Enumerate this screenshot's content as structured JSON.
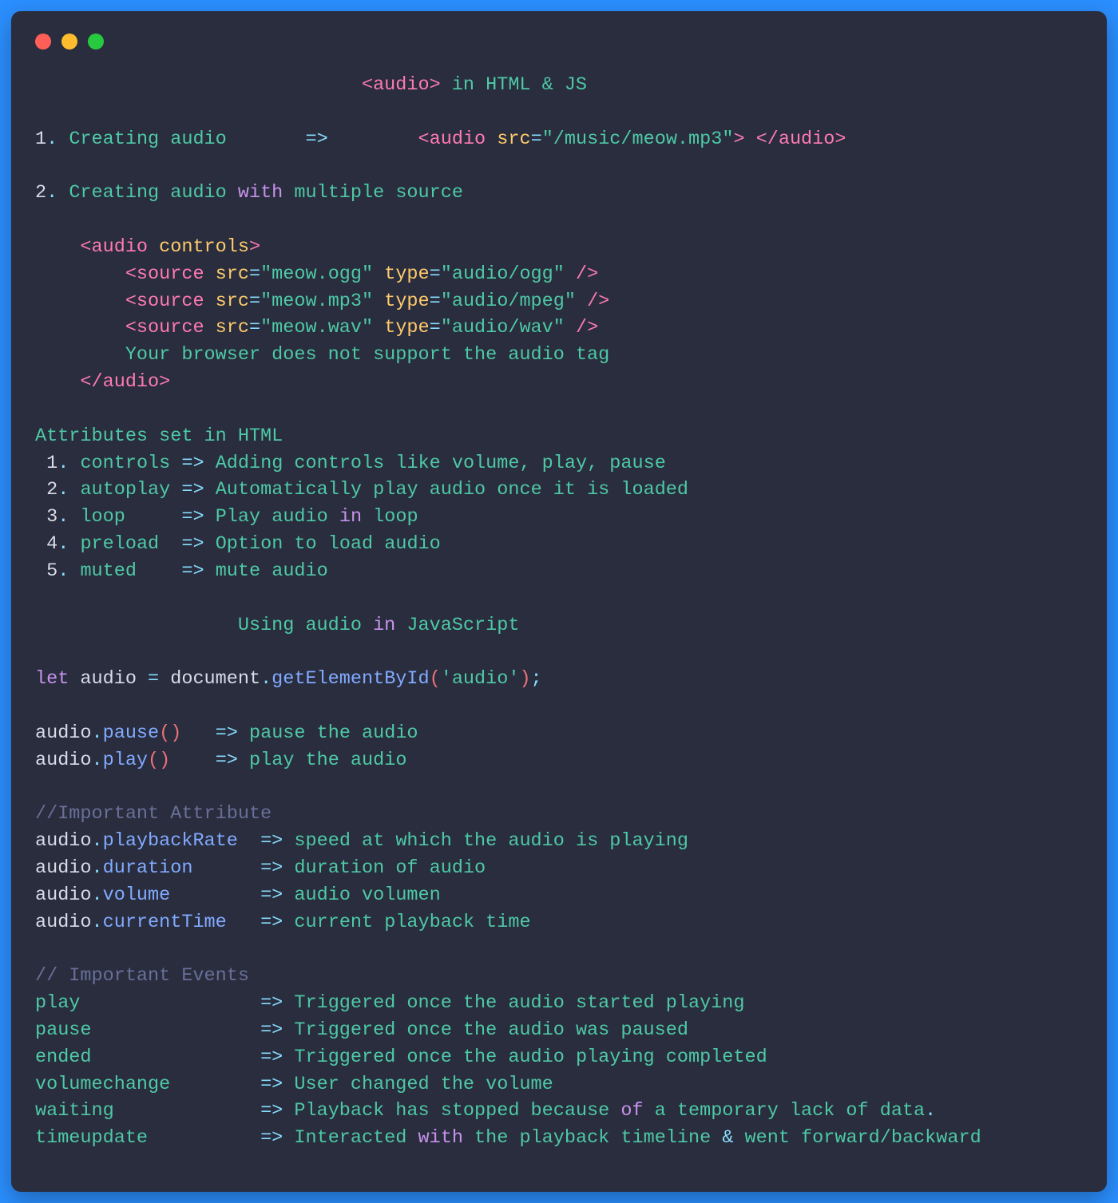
{
  "title_parts": {
    "audio_tag": "<audio>",
    "in": " in ",
    "html_js": "HTML & JS"
  },
  "section1": {
    "num": "1",
    "dot": ". ",
    "label": "Creating audio",
    "arrow": "=>",
    "audio_open": "<audio",
    "src_attr": " src",
    "eq": "=",
    "src_val": "\"/music/meow.mp3\"",
    "close_gt": ">",
    "audio_close": " </audio>"
  },
  "section2": {
    "num": "2",
    "dot": ". ",
    "label": "Creating audio ",
    "with": "with",
    "rest": " multiple source"
  },
  "audio_block": {
    "open_tag": "<audio",
    "controls": " controls",
    "gt": ">",
    "sources": [
      {
        "src": "\"meow.ogg\"",
        "type": "\"audio/ogg\""
      },
      {
        "src": "\"meow.mp3\"",
        "type": "\"audio/mpeg\""
      },
      {
        "src": "\"meow.wav\"",
        "type": "\"audio/wav\""
      }
    ],
    "source_tag": "<source",
    "src_lbl": " src",
    "type_lbl": " type",
    "self_close": " />",
    "fallback": "Your browser does not support the audio tag",
    "close_tag": "</audio>"
  },
  "attrs_heading": "Attributes set in HTML",
  "attributes": [
    {
      "n": "1",
      "name": "controls",
      "pad": " ",
      "desc": "Adding controls like volume, play, pause"
    },
    {
      "n": "2",
      "name": "autoplay",
      "pad": " ",
      "desc": "Automatically play audio once it is loaded"
    },
    {
      "n": "3",
      "name": "loop",
      "pad": "     ",
      "desc_pre": "Play audio ",
      "in": "in",
      "desc_post": " loop"
    },
    {
      "n": "4",
      "name": "preload",
      "pad": "  ",
      "desc": "Option to load audio"
    },
    {
      "n": "5",
      "name": "muted",
      "pad": "    ",
      "desc": "mute audio"
    }
  ],
  "js_heading": {
    "using": "Using audio ",
    "in": "in",
    "js": " JavaScript"
  },
  "let_line": {
    "let": "let",
    "var": " audio ",
    "eq": "=",
    "doc": " document",
    "dot": ".",
    "fn": "getElementById",
    "lp": "(",
    "arg": "'audio'",
    "rp_semi": ");"
  },
  "methods": [
    {
      "obj": "audio",
      "dot": ".",
      "name": "pause",
      "parens": "()",
      "pad": "   ",
      "desc": "pause the audio"
    },
    {
      "obj": "audio",
      "dot": ".",
      "name": "play",
      "parens": "()",
      "pad": "    ",
      "desc": "play the audio"
    }
  ],
  "imp_attr_comment": "//Important Attribute",
  "imp_attrs": [
    {
      "obj": "audio",
      "name": "playbackRate",
      "pad": "  ",
      "desc": "speed at which the audio is playing"
    },
    {
      "obj": "audio",
      "name": "duration",
      "pad": "      ",
      "desc": "duration of audio"
    },
    {
      "obj": "audio",
      "name": "volume",
      "pad": "        ",
      "desc": "audio volumen"
    },
    {
      "obj": "audio",
      "name": "currentTime",
      "pad": "   ",
      "desc": "current playback time"
    }
  ],
  "imp_events_comment": "// Important Events",
  "events": [
    {
      "name": "play",
      "pad": "                ",
      "desc": "Triggered once the audio started playing"
    },
    {
      "name": "pause",
      "pad": "               ",
      "desc": "Triggered once the audio was paused"
    },
    {
      "name": "ended",
      "pad": "               ",
      "desc": "Triggered once the audio playing completed"
    },
    {
      "name": "volumechange",
      "pad": "        ",
      "desc": "User changed the volume"
    },
    {
      "name": "waiting",
      "pad": "             ",
      "desc_pre": "Playback has stopped because ",
      "of": "of",
      "desc_post": " a temporary lack of data",
      "dot": "."
    },
    {
      "name": "timeupdate",
      "pad": "          ",
      "desc_pre": "Interacted ",
      "with": "with",
      "desc_mid": " the playback timeline ",
      "amp": "&",
      "desc_post": " went forward/backward"
    }
  ],
  "arrow": "=>",
  "eq": "="
}
